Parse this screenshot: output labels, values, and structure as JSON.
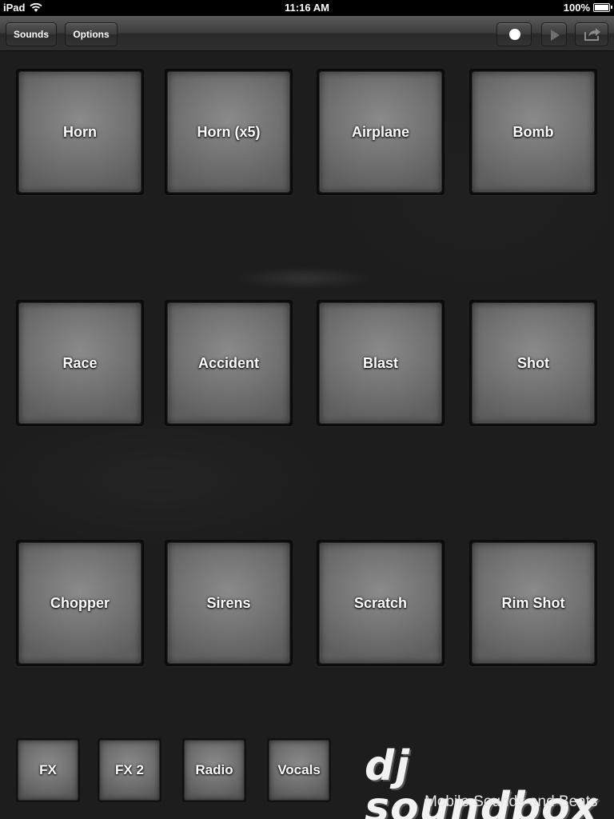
{
  "status_bar": {
    "carrier": "iPad",
    "time": "11:16 AM",
    "battery": "100%"
  },
  "toolbar": {
    "sounds_label": "Sounds",
    "options_label": "Options",
    "record_icon": "record-icon",
    "play_icon": "play-icon",
    "share_icon": "share-icon"
  },
  "pads": [
    {
      "label": "Horn"
    },
    {
      "label": "Horn (x5)"
    },
    {
      "label": "Airplane"
    },
    {
      "label": "Bomb"
    },
    {
      "label": "Race"
    },
    {
      "label": "Accident"
    },
    {
      "label": "Blast"
    },
    {
      "label": "Shot"
    },
    {
      "label": "Chopper"
    },
    {
      "label": "Sirens"
    },
    {
      "label": "Scratch"
    },
    {
      "label": "Rim Shot"
    }
  ],
  "categories": [
    {
      "label": "FX"
    },
    {
      "label": "FX 2"
    },
    {
      "label": "Radio"
    },
    {
      "label": "Vocals"
    }
  ],
  "logo": {
    "name": "dj soundbox",
    "tagline": "Mobile Sounds and Beats"
  }
}
